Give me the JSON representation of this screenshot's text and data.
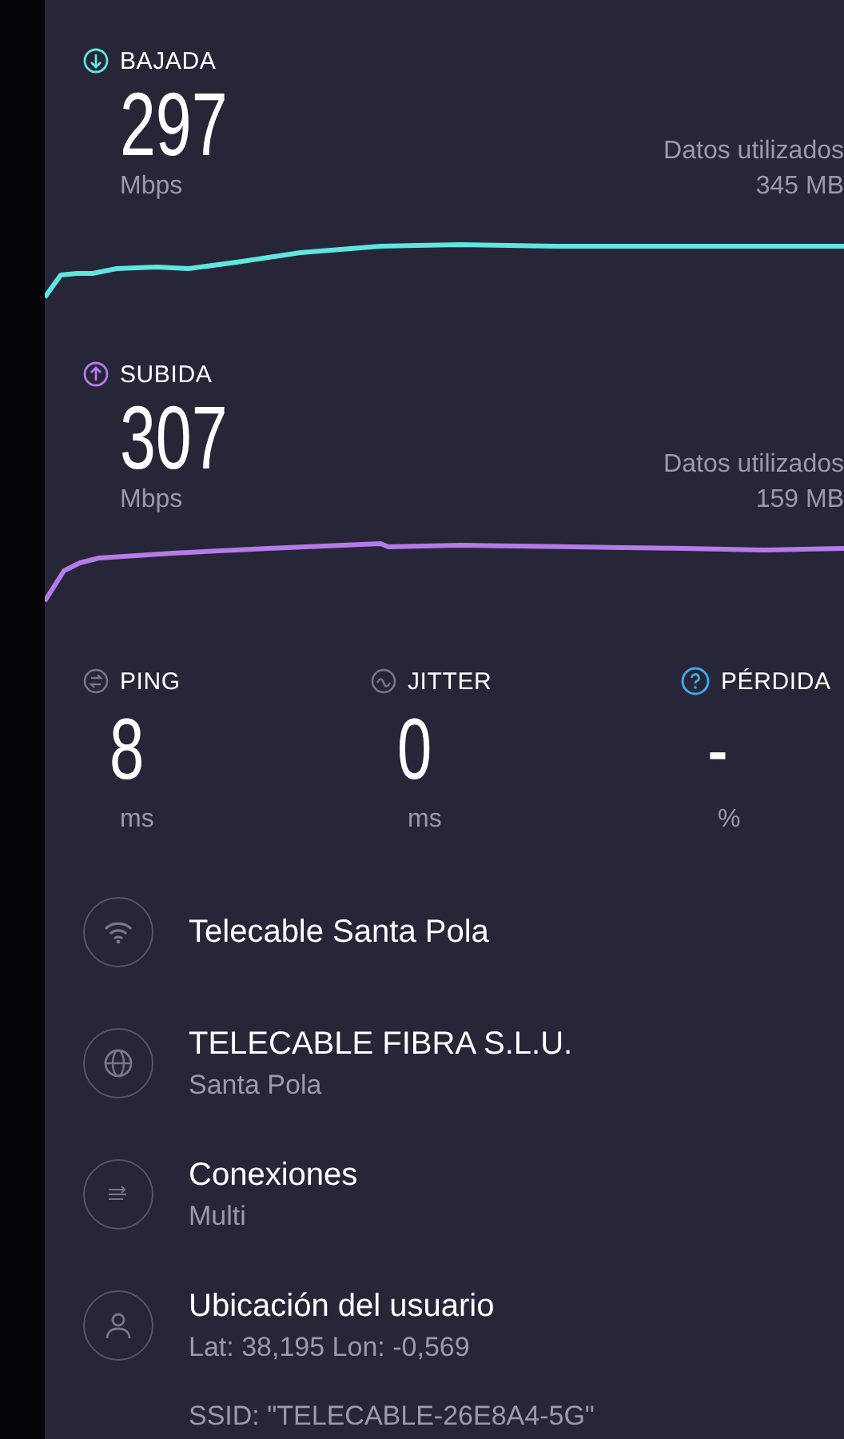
{
  "speeds": [
    {
      "kind": "down",
      "label": "BAJADA",
      "value": "297",
      "unit": "Mbps",
      "data_label": "Datos utilizados",
      "data_value": "345 MB",
      "color": "#5ee6e0"
    },
    {
      "kind": "up",
      "label": "SUBIDA",
      "value": "307",
      "unit": "Mbps",
      "data_label": "Datos utilizados",
      "data_value": "159 MB",
      "color": "#b57be8"
    }
  ],
  "metrics": [
    {
      "kind": "ping",
      "label": "PING",
      "value": "8",
      "unit": "ms"
    },
    {
      "kind": "jitter",
      "label": "JITTER",
      "value": "0",
      "unit": "ms"
    },
    {
      "kind": "loss",
      "label": "PÉRDIDA",
      "value": "-",
      "unit": "%"
    }
  ],
  "info": [
    {
      "kind": "wifi",
      "title": "Telecable Santa Pola"
    },
    {
      "kind": "globe",
      "title": "TELECABLE FIBRA S.L.U.",
      "subtitle": "Santa Pola"
    },
    {
      "kind": "connections",
      "title": "Conexiones",
      "subtitle": "Multi"
    },
    {
      "kind": "user",
      "title": "Ubicación del usuario",
      "subtitle": "Lat: 38,195 Lon: -0,569"
    }
  ],
  "ssid": "SSID: \"TELECABLE-26E8A4-5G\""
}
